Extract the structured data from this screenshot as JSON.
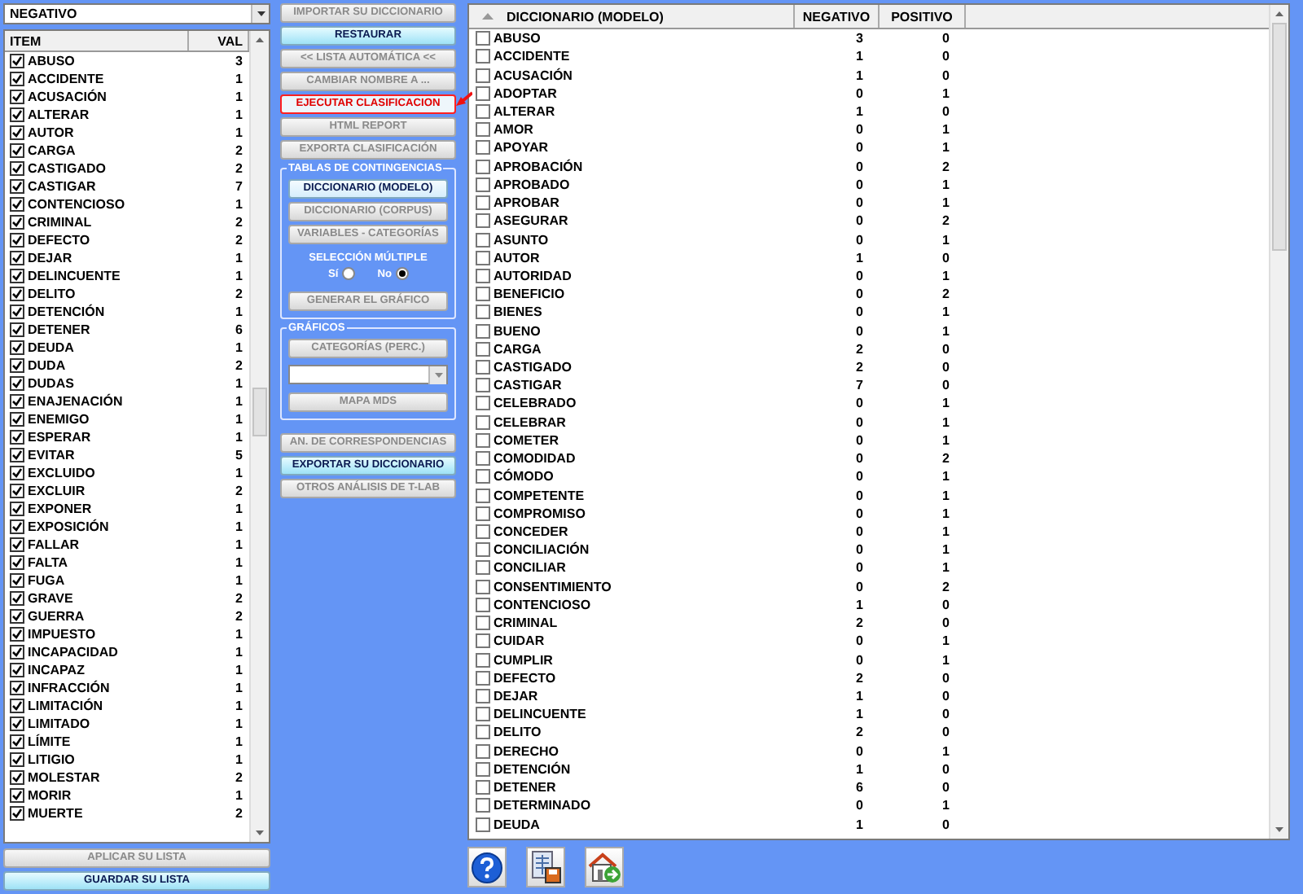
{
  "left_panel": {
    "dropdown": {
      "value": "NEGATIVO"
    },
    "list": {
      "columns": [
        "ITEM",
        "VAL"
      ],
      "rows": [
        {
          "item": "ABUSO",
          "value": "3",
          "checked": true
        },
        {
          "item": "ACCIDENTE",
          "value": "1",
          "checked": true
        },
        {
          "item": "ACUSACIÓN",
          "value": "1",
          "checked": true
        },
        {
          "item": "ALTERAR",
          "value": "1",
          "checked": true
        },
        {
          "item": "AUTOR",
          "value": "1",
          "checked": true
        },
        {
          "item": "CARGA",
          "value": "2",
          "checked": true
        },
        {
          "item": "CASTIGADO",
          "value": "2",
          "checked": true
        },
        {
          "item": "CASTIGAR",
          "value": "7",
          "checked": true
        },
        {
          "item": "CONTENCIOSO",
          "value": "1",
          "checked": true
        },
        {
          "item": "CRIMINAL",
          "value": "2",
          "checked": true
        },
        {
          "item": "DEFECTO",
          "value": "2",
          "checked": true
        },
        {
          "item": "DEJAR",
          "value": "1",
          "checked": true
        },
        {
          "item": "DELINCUENTE",
          "value": "1",
          "checked": true
        },
        {
          "item": "DELITO",
          "value": "2",
          "checked": true
        },
        {
          "item": "DETENCIÓN",
          "value": "1",
          "checked": true
        },
        {
          "item": "DETENER",
          "value": "6",
          "checked": true
        },
        {
          "item": "DEUDA",
          "value": "1",
          "checked": true
        },
        {
          "item": "DUDA",
          "value": "2",
          "checked": true
        },
        {
          "item": "DUDAS",
          "value": "1",
          "checked": true
        },
        {
          "item": "ENAJENACIÓN",
          "value": "1",
          "checked": true
        },
        {
          "item": "ENEMIGO",
          "value": "1",
          "checked": true
        },
        {
          "item": "ESPERAR",
          "value": "1",
          "checked": true
        },
        {
          "item": "EVITAR",
          "value": "5",
          "checked": true
        },
        {
          "item": "EXCLUIDO",
          "value": "1",
          "checked": true
        },
        {
          "item": "EXCLUIR",
          "value": "2",
          "checked": true
        },
        {
          "item": "EXPONER",
          "value": "1",
          "checked": true
        },
        {
          "item": "EXPOSICIÓN",
          "value": "1",
          "checked": true
        },
        {
          "item": "FALLAR",
          "value": "1",
          "checked": true
        },
        {
          "item": "FALTA",
          "value": "1",
          "checked": true
        },
        {
          "item": "FUGA",
          "value": "1",
          "checked": true
        },
        {
          "item": "GRAVE",
          "value": "2",
          "checked": true
        },
        {
          "item": "GUERRA",
          "value": "2",
          "checked": true
        },
        {
          "item": "IMPUESTO",
          "value": "1",
          "checked": true
        },
        {
          "item": "INCAPACIDAD",
          "value": "1",
          "checked": true
        },
        {
          "item": "INCAPAZ",
          "value": "1",
          "checked": true
        },
        {
          "item": "INFRACCIÓN",
          "value": "1",
          "checked": true
        },
        {
          "item": "LIMITACIÓN",
          "value": "1",
          "checked": true
        },
        {
          "item": "LIMITADO",
          "value": "1",
          "checked": true
        },
        {
          "item": "LÍMITE",
          "value": "1",
          "checked": true
        },
        {
          "item": "LITIGIO",
          "value": "1",
          "checked": true
        },
        {
          "item": "MOLESTAR",
          "value": "2",
          "checked": true
        },
        {
          "item": "MORIR",
          "value": "1",
          "checked": true
        },
        {
          "item": "MUERTE",
          "value": "2",
          "checked": true
        }
      ]
    },
    "buttons": [
      {
        "label": "APLICAR SU LISTA",
        "kind": "plain",
        "disabled": true
      },
      {
        "label": "GUARDAR SU LISTA",
        "kind": "accent",
        "disabled": false
      }
    ]
  },
  "actions": {
    "top_buttons": [
      {
        "label": "IMPORTAR SU DICCIONARIO",
        "kind": "plain",
        "disabled": true
      },
      {
        "label": "RESTAURAR",
        "kind": "accent",
        "disabled": false
      },
      {
        "label": "<< LISTA AUTOMÁTICA <<",
        "kind": "plain",
        "disabled": true
      },
      {
        "label": "CAMBIAR NOMBRE A ...",
        "kind": "plain",
        "disabled": true
      },
      {
        "label": "EJECUTAR CLASIFICACION",
        "kind": "warning",
        "disabled": false
      },
      {
        "label": "HTML REPORT",
        "kind": "plain",
        "disabled": true
      },
      {
        "label": "EXPORTA CLASIFICACIÓN",
        "kind": "plain",
        "disabled": true
      }
    ],
    "contingency_group": {
      "title": "TABLAS DE CONTINGENCIAS",
      "buttons": [
        {
          "label": "DICCIONARIO (MODELO)",
          "kind": "light",
          "disabled": false
        },
        {
          "label": "DICCIONARIO (CORPUS)",
          "kind": "plain",
          "disabled": true
        },
        {
          "label": "VARIABLES - CATEGORÍAS",
          "kind": "plain",
          "disabled": true
        }
      ],
      "multiple_selection": {
        "label": "SELECCIÓN MÚLTIPLE",
        "options": [
          {
            "label": "Sí",
            "selected": false
          },
          {
            "label": "No",
            "selected": true
          }
        ]
      },
      "chart_button": {
        "label": "GENERAR EL GRÁFICO",
        "kind": "plain",
        "disabled": true
      }
    },
    "charts_group": {
      "title": "GRÁFICOS",
      "category_button": {
        "label": "CATEGORÍAS  (PERC.)",
        "kind": "plain",
        "disabled": true
      },
      "map_button": {
        "label": "MAPA  MDS",
        "kind": "plain",
        "disabled": true
      }
    },
    "bottom_buttons": [
      {
        "label": "AN. DE CORRESPONDENCIAS",
        "kind": "plain",
        "disabled": true
      },
      {
        "label": "EXPORTAR SU DICCIONARIO",
        "kind": "accent",
        "disabled": false
      },
      {
        "label": "OTROS ANÁLISIS DE T-LAB",
        "kind": "plain",
        "disabled": true
      }
    ]
  },
  "dictionary_table": {
    "columns": [
      "DICCIONARIO (MODELO)",
      "NEGATIVO",
      "POSITIVO"
    ],
    "rows": [
      {
        "item": "ABUSO",
        "negative": "3",
        "positive": "0",
        "checked": false
      },
      {
        "item": "ACCIDENTE",
        "negative": "1",
        "positive": "0",
        "checked": false
      },
      {
        "item": "ACUSACIÓN",
        "negative": "1",
        "positive": "0",
        "checked": false
      },
      {
        "item": "ADOPTAR",
        "negative": "0",
        "positive": "1",
        "checked": false
      },
      {
        "item": "ALTERAR",
        "negative": "1",
        "positive": "0",
        "checked": false
      },
      {
        "item": "AMOR",
        "negative": "0",
        "positive": "1",
        "checked": false
      },
      {
        "item": "APOYAR",
        "negative": "0",
        "positive": "1",
        "checked": false
      },
      {
        "item": "APROBACIÓN",
        "negative": "0",
        "positive": "2",
        "checked": false
      },
      {
        "item": "APROBADO",
        "negative": "0",
        "positive": "1",
        "checked": false
      },
      {
        "item": "APROBAR",
        "negative": "0",
        "positive": "1",
        "checked": false
      },
      {
        "item": "ASEGURAR",
        "negative": "0",
        "positive": "2",
        "checked": false
      },
      {
        "item": "ASUNTO",
        "negative": "0",
        "positive": "1",
        "checked": false
      },
      {
        "item": "AUTOR",
        "negative": "1",
        "positive": "0",
        "checked": false
      },
      {
        "item": "AUTORIDAD",
        "negative": "0",
        "positive": "1",
        "checked": false
      },
      {
        "item": "BENEFICIO",
        "negative": "0",
        "positive": "2",
        "checked": false
      },
      {
        "item": "BIENES",
        "negative": "0",
        "positive": "1",
        "checked": false
      },
      {
        "item": "BUENO",
        "negative": "0",
        "positive": "1",
        "checked": false
      },
      {
        "item": "CARGA",
        "negative": "2",
        "positive": "0",
        "checked": false
      },
      {
        "item": "CASTIGADO",
        "negative": "2",
        "positive": "0",
        "checked": false
      },
      {
        "item": "CASTIGAR",
        "negative": "7",
        "positive": "0",
        "checked": false
      },
      {
        "item": "CELEBRADO",
        "negative": "0",
        "positive": "1",
        "checked": false
      },
      {
        "item": "CELEBRAR",
        "negative": "0",
        "positive": "1",
        "checked": false
      },
      {
        "item": "COMETER",
        "negative": "0",
        "positive": "1",
        "checked": false
      },
      {
        "item": "COMODIDAD",
        "negative": "0",
        "positive": "2",
        "checked": false
      },
      {
        "item": "CÓMODO",
        "negative": "0",
        "positive": "1",
        "checked": false
      },
      {
        "item": "COMPETENTE",
        "negative": "0",
        "positive": "1",
        "checked": false
      },
      {
        "item": "COMPROMISO",
        "negative": "0",
        "positive": "1",
        "checked": false
      },
      {
        "item": "CONCEDER",
        "negative": "0",
        "positive": "1",
        "checked": false
      },
      {
        "item": "CONCILIACIÓN",
        "negative": "0",
        "positive": "1",
        "checked": false
      },
      {
        "item": "CONCILIAR",
        "negative": "0",
        "positive": "1",
        "checked": false
      },
      {
        "item": "CONSENTIMIENTO",
        "negative": "0",
        "positive": "2",
        "checked": false
      },
      {
        "item": "CONTENCIOSO",
        "negative": "1",
        "positive": "0",
        "checked": false
      },
      {
        "item": "CRIMINAL",
        "negative": "2",
        "positive": "0",
        "checked": false
      },
      {
        "item": "CUIDAR",
        "negative": "0",
        "positive": "1",
        "checked": false
      },
      {
        "item": "CUMPLIR",
        "negative": "0",
        "positive": "1",
        "checked": false
      },
      {
        "item": "DEFECTO",
        "negative": "2",
        "positive": "0",
        "checked": false
      },
      {
        "item": "DEJAR",
        "negative": "1",
        "positive": "0",
        "checked": false
      },
      {
        "item": "DELINCUENTE",
        "negative": "1",
        "positive": "0",
        "checked": false
      },
      {
        "item": "DELITO",
        "negative": "2",
        "positive": "0",
        "checked": false
      },
      {
        "item": "DERECHO",
        "negative": "0",
        "positive": "1",
        "checked": false
      },
      {
        "item": "DETENCIÓN",
        "negative": "1",
        "positive": "0",
        "checked": false
      },
      {
        "item": "DETENER",
        "negative": "6",
        "positive": "0",
        "checked": false
      },
      {
        "item": "DETERMINADO",
        "negative": "0",
        "positive": "1",
        "checked": false
      },
      {
        "item": "DEUDA",
        "negative": "1",
        "positive": "0",
        "checked": false
      }
    ]
  },
  "toolbar": {
    "buttons": [
      {
        "kind": "help"
      },
      {
        "kind": "export"
      },
      {
        "kind": "home"
      }
    ]
  }
}
